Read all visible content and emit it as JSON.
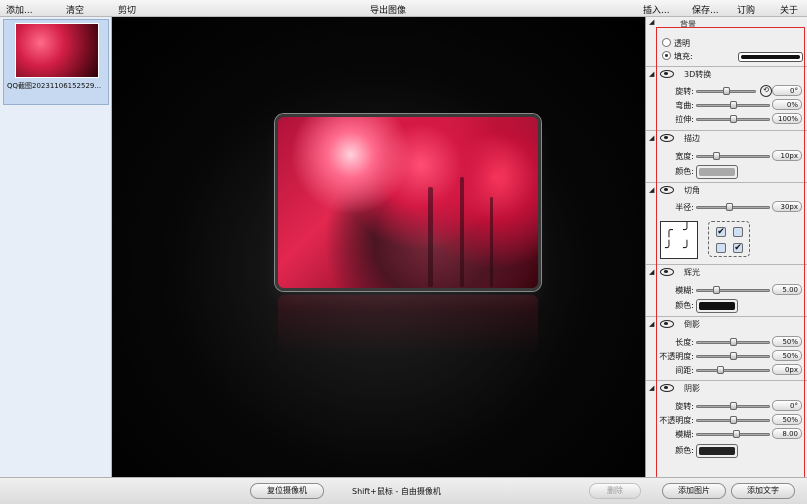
{
  "menubar": {
    "add": "添加...",
    "clear": "清空",
    "crop": "剪切",
    "export": "导出图像",
    "insert": "插入...",
    "save": "保存...",
    "subscribe": "订购",
    "about": "关于"
  },
  "thumbnail": {
    "caption": "QQ截图20231106152529..."
  },
  "bottom": {
    "reset_camera": "复位摄像机",
    "hint": "Shift+鼠标 - 自由摄像机",
    "delete": "删除",
    "add_image": "添加图片",
    "add_text": "添加文字"
  },
  "colors": {
    "highlight": "#dd2a2a",
    "fill": "#111111",
    "border_color": "#a9a9a9",
    "glow_color": "#111111",
    "shadow_color": "#222222"
  },
  "panel": {
    "background": {
      "title": "背景",
      "transparent": "透明",
      "fill": "填充:",
      "selected": "fill"
    },
    "transform3d": {
      "title": "3D转换",
      "rotate_label": "旋转:",
      "rotate_value": "0°",
      "bend_label": "弯曲:",
      "bend_value": "0%",
      "stretch_label": "拉伸:",
      "stretch_value": "100%"
    },
    "border": {
      "title": "描边",
      "width_label": "宽度:",
      "width_value": "10px",
      "color_label": "颜色:"
    },
    "corner": {
      "title": "切角",
      "radius_label": "半径:",
      "radius_value": "30px"
    },
    "glow": {
      "title": "辉光",
      "blur_label": "模糊:",
      "blur_value": "5.00",
      "color_label": "颜色:"
    },
    "reflection": {
      "title": "倒影",
      "length_label": "长度:",
      "length_value": "50%",
      "opacity_label": "不透明度:",
      "opacity_value": "50%",
      "gap_label": "间距:",
      "gap_value": "0px"
    },
    "shadow": {
      "title": "阴影",
      "rotate_label": "旋转:",
      "rotate_value": "0°",
      "opacity_label": "不透明度:",
      "opacity_value": "50%",
      "blur_label": "模糊:",
      "blur_value": "8.00",
      "color_label": "颜色:"
    }
  },
  "sliders": {
    "rotate3d": 0.5,
    "bend": 0.5,
    "stretch": 0.5,
    "border_width": 0.25,
    "corner_radius": 0.45,
    "glow_blur": 0.25,
    "refl_length": 0.5,
    "refl_opacity": 0.5,
    "refl_gap": 0.3,
    "shadow_rotate": 0.5,
    "shadow_opacity": 0.5,
    "shadow_blur": 0.55
  }
}
